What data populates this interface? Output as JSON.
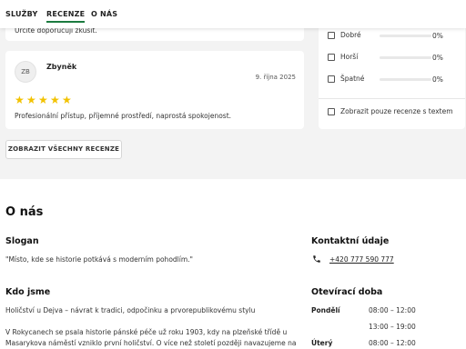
{
  "nav": {
    "tabs": [
      "SLUŽBY",
      "RECENZE",
      "O NÁS"
    ],
    "active": "RECENZE"
  },
  "reviews": {
    "prev_snippet": "Určitě doporučuji zkusit.",
    "review": {
      "initials": "ZB",
      "name": "Zbyněk",
      "date": "9. října 2025",
      "stars": 5,
      "text": "Profesionální přístup, příjemné prostředí, naprostá spokojenost."
    },
    "show_all": "ZOBRAZIT VŠECHNY RECENZE"
  },
  "filters": {
    "items": [
      {
        "label": "Dobré",
        "pct": "0%",
        "fill": 0
      },
      {
        "label": "Horší",
        "pct": "0%",
        "fill": 0
      },
      {
        "label": "Špatné",
        "pct": "0%",
        "fill": 0
      }
    ],
    "text_only": "Zobrazit pouze recenze s textem"
  },
  "about": {
    "title": "O nás",
    "slogan_title": "Slogan",
    "slogan": "\"Místo, kde se historie potkává s moderním pohodlím.\"",
    "who_title": "Kdo jsme",
    "who_line1": "Holičství u Dejva – návrat k tradici, odpočinku a prvorepublikovému stylu",
    "who_line2": "V Rokycanech se psala historie pánské péče už roku 1903, kdy na plzeňské třídě u",
    "who_line3": "Masarykova náměstí vzniklo první holičství. O více než století později navazujeme na"
  },
  "contact": {
    "title": "Kontaktní údaje",
    "phone": "+420 777 590 777",
    "phone_icon": "phone-icon"
  },
  "hours": {
    "title": "Otevírací doba",
    "rows": [
      {
        "day": "Pondělí",
        "time": "08:00 – 12:00"
      },
      {
        "day": "",
        "time": "13:00 – 19:00"
      },
      {
        "day": "Úterý",
        "time": "08:00 – 12:00"
      }
    ]
  },
  "colors": {
    "accent": "#1b7a3f",
    "star": "#f2c200",
    "band": "#f3f3f3"
  }
}
